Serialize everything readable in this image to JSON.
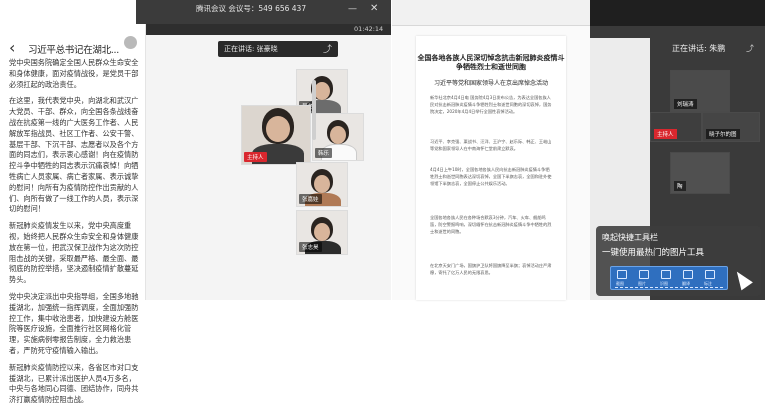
{
  "phone": {
    "back_icon": "chevron-left",
    "title": "习近平总书记在湖北...",
    "paragraphs": [
      "党中央国务院确定全国人民群众生命安全和身体健康，面对疫情战役，是党员干部必须扛起的政治责任。",
      "在这里，我代表党中央，向湖北和武汉广大党员、干部、群众，向全国各条战线奋战在抗疫第一线的广大医务工作者、人民解放军指战员、社区工作者、公安干警、基层干部、下沉干部、志愿者以及各个方面的同志们，表示衷心感谢！向在疫情防控斗争中牺牲的同志表示沉痛哀悼！向牺牲病亡人员家属、病亡者家属、表示诚挚的慰问！向所有为疫情防控作出贡献的人们、向所有做了一线工作的人员，表示深切的慰问！",
      "新冠肺炎疫情发生以来，党中央高度重视，始终把人民群众生命安全和身体健康放在第一位，把武汉保卫战作为这次防控阻击战的关键，采取最严格、最全面、最彻底的防控举措，坚决遏制疫情扩散蔓延势头。",
      "党中央决定派出中央指导组，全国多地驰援湖北，加强统一指挥调度，全面加强防控工作，集中收治患者，加快建设方舱医院等医疗设施，全面推行社区网格化管理，实施病例零报告制度，全力救治患者，严防死守疫情输入输出。",
      "新冠肺炎疫情防控以来，各省区市对口支援湖北，已累计派出医护人员4万多名，中央与各地同心同德、团结协作，同舟共济打赢疫情防控阻击战。"
    ]
  },
  "meeting_top": {
    "meeting_id": "腾讯会议 会议号：549 656 437",
    "minimize_icon": "minus-icon",
    "close_icon": "close-icon",
    "timer": "01:42:14"
  },
  "grid": {
    "speaker_label": "正在讲话: 张豪晓",
    "expand_icon": "arrow-icon",
    "tiles": [
      {
        "name": "吴老"
      },
      {
        "name": "主持人"
      },
      {
        "name": "韩乐"
      },
      {
        "name": "张嘉娃"
      },
      {
        "name": "张志昊"
      }
    ]
  },
  "document": {
    "title": "全国各地各族人民深切悼念抗击新冠肺炎疫情斗争牺牲烈士和逝世同胞",
    "subtitle": "习近平等党和国家领导人在京出席悼念活动",
    "paragraphs": [
      "新华社北京4月4日电 国务院4月3日发布公告，为表达全国各族人民对抗击新冠肺炎疫情斗争牺牲烈士和逝世同胞的深切哀悼，国务院决定，2020年4月4日举行全国性哀悼活动。",
      "习近平、李克强、栗战书、汪洋、王沪宁、赵乐际、韩正、王岐山等党和国家领导人在中南海怀仁堂前肃立默哀。",
      "4月4日上午10时，全国各地各族人民向抗击新冠肺炎疫情斗争牺牲烈士和逝世同胞表达深切哀悼，全国下半旗志哀，全国和驻外使领馆下半旗志哀，全国停止公共娱乐活动。",
      "全国各地各族人民在各种场合默哀3分钟，汽车、火车、舰船鸣笛，防空警报鸣响，深切缅怀在抗击新冠肺炎疫情斗争中牺牲的烈士和逝世的同胞。",
      "在北京天安门广场，国旗护卫队将国旗降至半旗；哀悼活动庄严肃穆，寄托了亿万人民的无限哀思。"
    ]
  },
  "right_panel": {
    "speaker_label": "正在讲话: 朱鹏",
    "tiles": [
      {
        "name": "刘瑞涛"
      },
      {
        "name": "主持人"
      },
      {
        "name": "晓子尔的图"
      },
      {
        "name": "陶"
      }
    ],
    "tip": {
      "line1": "唤起快捷工具栏",
      "line2": "一键使用最热门的图片工具",
      "tools": [
        "截图",
        "图片",
        "识图",
        "翻译",
        "标注"
      ]
    }
  }
}
